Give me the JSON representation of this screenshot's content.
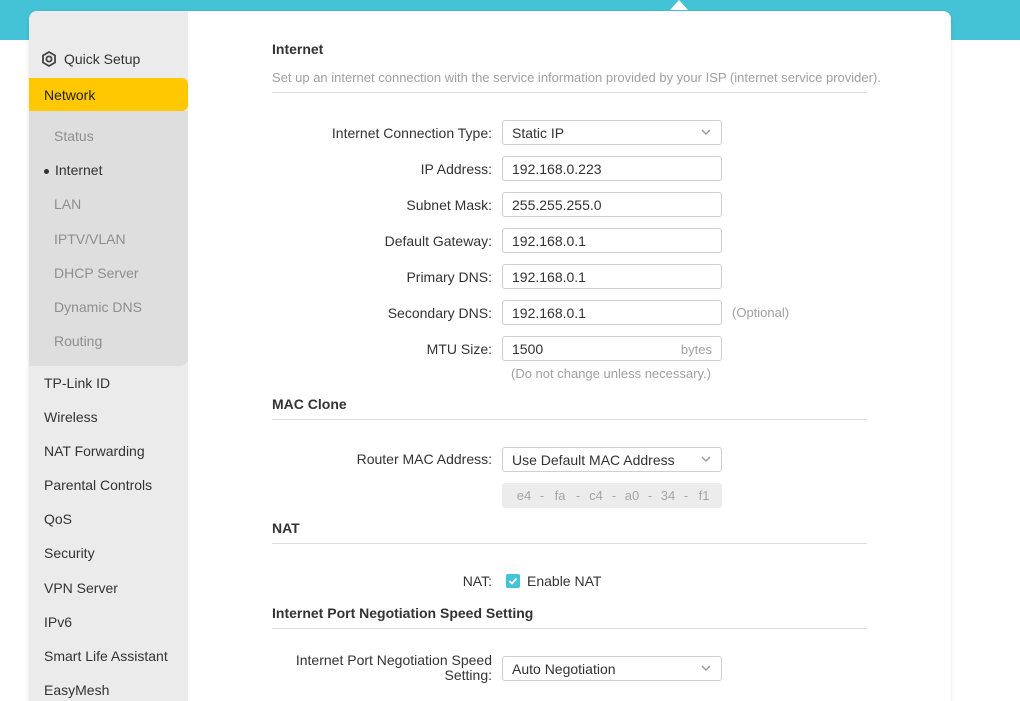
{
  "sidebar": {
    "quick_setup": "Quick Setup",
    "active_section": "Network",
    "sub_items": [
      "Status",
      "Internet",
      "LAN",
      "IPTV/VLAN",
      "DHCP Server",
      "Dynamic DNS",
      "Routing"
    ],
    "current_sub_item": "Internet",
    "items": [
      "TP-Link ID",
      "Wireless",
      "NAT Forwarding",
      "Parental Controls",
      "QoS",
      "Security",
      "VPN Server",
      "IPv6",
      "Smart Life Assistant",
      "EasyMesh"
    ]
  },
  "internet": {
    "title": "Internet",
    "description": "Set up an internet connection with the service information provided by your ISP (internet service provider).",
    "connection_type_label": "Internet Connection Type:",
    "connection_type_value": "Static IP",
    "ip_label": "IP Address:",
    "ip_value": "192.168.0.223",
    "subnet_label": "Subnet Mask:",
    "subnet_value": "255.255.255.0",
    "gateway_label": "Default Gateway:",
    "gateway_value": "192.168.0.1",
    "primary_dns_label": "Primary DNS:",
    "primary_dns_value": "192.168.0.1",
    "secondary_dns_label": "Secondary DNS:",
    "secondary_dns_value": "192.168.0.1",
    "optional_note": "(Optional)",
    "mtu_label": "MTU Size:",
    "mtu_value": "1500",
    "mtu_unit": "bytes",
    "mtu_note": "(Do not change unless necessary.)"
  },
  "mac_clone": {
    "title": "MAC Clone",
    "router_mac_label": "Router MAC Address:",
    "router_mac_value": "Use Default MAC Address",
    "mac_octets": [
      "e4",
      "fa",
      "c4",
      "a0",
      "34",
      "f1"
    ],
    "separator": "-"
  },
  "nat": {
    "title": "NAT",
    "label": "NAT:",
    "checkbox_label": "Enable NAT",
    "enabled": true
  },
  "port_speed": {
    "title": "Internet Port Negotiation Speed Setting",
    "label_line1": "Internet Port Negotiation Speed",
    "label_line2": "Setting:",
    "value": "Auto Negotiation"
  },
  "colors": {
    "accent": "#45c3d6",
    "active_nav": "#ffc800",
    "sidebar_bg": "#ebebeb",
    "subnav_bg": "#dedede"
  }
}
